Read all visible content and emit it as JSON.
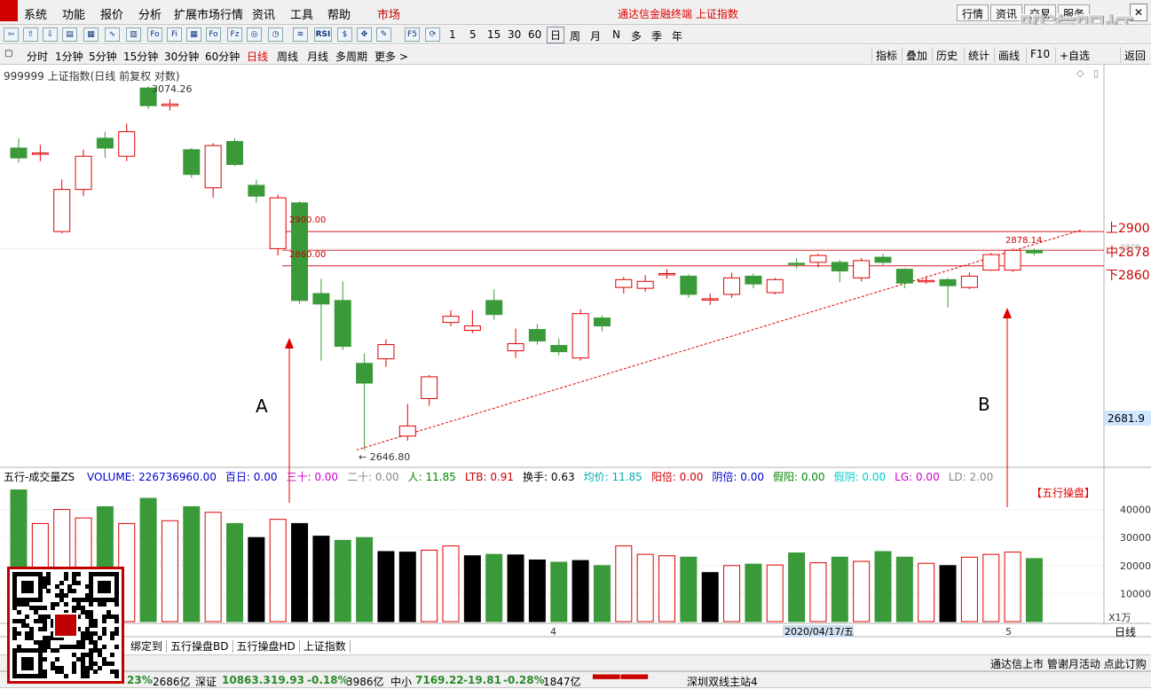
{
  "menu": {
    "items": [
      "系统",
      "功能",
      "报价",
      "分析",
      "扩展市场行情",
      "资讯",
      "工具",
      "帮助"
    ],
    "active": "市场",
    "title": "通达信金融终端 上证指数",
    "right_buttons": [
      "行情",
      "资讯",
      "交易",
      "服务"
    ],
    "watermark": "股海明灯"
  },
  "toolbar": {
    "periods": [
      "1",
      "5",
      "15",
      "30",
      "60"
    ],
    "units": [
      "日",
      "周",
      "月",
      "N",
      "多",
      "季",
      "年"
    ]
  },
  "periodbar": {
    "items": [
      "分时",
      "1分钟",
      "5分钟",
      "15分钟",
      "30分钟",
      "60分钟",
      "日线",
      "周线",
      "月线",
      "多周期",
      "更多 >"
    ],
    "active": "日线",
    "right_tools": [
      "指标",
      "叠加",
      "历史",
      "统计",
      "画线",
      "F10",
      "+自选",
      "返回"
    ]
  },
  "chart": {
    "header": "999999 上证指数(日线 前复权 对数)",
    "high_label": "3074.26",
    "low_label": "2646.80",
    "hline_labels": [
      "2900.00",
      "2860.00"
    ],
    "last_label": "2878.14",
    "right_labels": {
      "upper": "上2900",
      "middle": "中2878",
      "lower": "下2860",
      "cur": "2681.9",
      "top_axis": "2878"
    },
    "annotations": {
      "a": "A",
      "b": "B",
      "box": "【五行操盘】"
    }
  },
  "chart_data": {
    "type": "candlestick",
    "scale": "log",
    "ylim_price": [
      2646.8,
      3074.26
    ],
    "hlines": [
      2900,
      2878,
      2860
    ],
    "candles": [
      {
        "o": 3000,
        "c": 2988,
        "h": 3012,
        "l": 2982
      },
      {
        "o": 2994,
        "c": 2994,
        "h": 3004,
        "l": 2984
      },
      {
        "o": 2900,
        "c": 2950,
        "h": 2962,
        "l": 2898
      },
      {
        "o": 2950,
        "c": 2990,
        "h": 2998,
        "l": 2942
      },
      {
        "o": 3012,
        "c": 3000,
        "h": 3020,
        "l": 2988
      },
      {
        "o": 2990,
        "c": 3020,
        "h": 3030,
        "l": 2984
      },
      {
        "o": 3074,
        "c": 3052,
        "h": 3076,
        "l": 3048
      },
      {
        "o": 3052,
        "c": 3054,
        "h": 3060,
        "l": 3046
      },
      {
        "o": 2998,
        "c": 2968,
        "h": 3000,
        "l": 2964
      },
      {
        "o": 2952,
        "c": 3003,
        "h": 3006,
        "l": 2940
      },
      {
        "o": 3008,
        "c": 2980,
        "h": 3012,
        "l": 2978
      },
      {
        "o": 2955,
        "c": 2942,
        "h": 2962,
        "l": 2934
      },
      {
        "o": 2880,
        "c": 2940,
        "h": 2944,
        "l": 2872
      },
      {
        "o": 2934,
        "c": 2820,
        "h": 2936,
        "l": 2816
      },
      {
        "o": 2828,
        "c": 2816,
        "h": 2845,
        "l": 2752
      },
      {
        "o": 2820,
        "c": 2768,
        "h": 2842,
        "l": 2764
      },
      {
        "o": 2749,
        "c": 2727,
        "h": 2760,
        "l": 2654
      },
      {
        "o": 2754,
        "c": 2770,
        "h": 2776,
        "l": 2745
      },
      {
        "o": 2669,
        "c": 2680,
        "h": 2704,
        "l": 2664
      },
      {
        "o": 2710,
        "c": 2734,
        "h": 2736,
        "l": 2702
      },
      {
        "o": 2795,
        "c": 2802,
        "h": 2809,
        "l": 2791
      },
      {
        "o": 2786,
        "c": 2791,
        "h": 2809,
        "l": 2783
      },
      {
        "o": 2820,
        "c": 2804,
        "h": 2833,
        "l": 2798
      },
      {
        "o": 2763,
        "c": 2771,
        "h": 2788,
        "l": 2755
      },
      {
        "o": 2787,
        "c": 2774,
        "h": 2793,
        "l": 2770
      },
      {
        "o": 2769,
        "c": 2762,
        "h": 2777,
        "l": 2758
      },
      {
        "o": 2755,
        "c": 2805,
        "h": 2810,
        "l": 2752
      },
      {
        "o": 2800,
        "c": 2791,
        "h": 2803,
        "l": 2785
      },
      {
        "o": 2835,
        "c": 2844,
        "h": 2847,
        "l": 2828
      },
      {
        "o": 2834,
        "c": 2842,
        "h": 2849,
        "l": 2830
      },
      {
        "o": 2851,
        "c": 2851,
        "h": 2856,
        "l": 2845
      },
      {
        "o": 2848,
        "c": 2827,
        "h": 2850,
        "l": 2823
      },
      {
        "o": 2822,
        "c": 2822,
        "h": 2828,
        "l": 2815
      },
      {
        "o": 2827,
        "c": 2846,
        "h": 2852,
        "l": 2823
      },
      {
        "o": 2848,
        "c": 2839,
        "h": 2851,
        "l": 2834
      },
      {
        "o": 2829,
        "c": 2844,
        "h": 2846,
        "l": 2827
      },
      {
        "o": 2863,
        "c": 2862,
        "h": 2869,
        "l": 2857
      },
      {
        "o": 2864,
        "c": 2872,
        "h": 2874,
        "l": 2858
      },
      {
        "o": 2864,
        "c": 2854,
        "h": 2867,
        "l": 2841
      },
      {
        "o": 2846,
        "c": 2866,
        "h": 2869,
        "l": 2842
      },
      {
        "o": 2870,
        "c": 2864,
        "h": 2874,
        "l": 2861
      },
      {
        "o": 2856,
        "c": 2840,
        "h": 2857,
        "l": 2834
      },
      {
        "o": 2843,
        "c": 2843,
        "h": 2848,
        "l": 2839
      },
      {
        "o": 2844,
        "c": 2837,
        "h": 2846,
        "l": 2812
      },
      {
        "o": 2835,
        "c": 2848,
        "h": 2852,
        "l": 2833
      },
      {
        "o": 2855,
        "c": 2873,
        "h": 2875,
        "l": 2854
      },
      {
        "o": 2855,
        "c": 2878,
        "h": 2880,
        "l": 2853
      },
      {
        "o": 2878,
        "c": 2875,
        "h": 2880,
        "l": 2872
      }
    ],
    "volume": {
      "ylim": [
        0,
        50000
      ],
      "ticks": [
        40000,
        30000,
        20000,
        10000
      ],
      "unit": "X1万",
      "values": [
        47000,
        35000,
        40000,
        37000,
        41000,
        35000,
        44000,
        36000,
        41000,
        39000,
        35000,
        30000,
        36500,
        35000,
        30500,
        29000,
        30000,
        25000,
        24800,
        25500,
        27000,
        23500,
        24000,
        23800,
        22000,
        21200,
        21800,
        20000,
        27000,
        24000,
        23500,
        23000,
        17500,
        20000,
        20500,
        20200,
        24500,
        21000,
        23000,
        21500,
        25000,
        23000,
        20800,
        20000,
        23000,
        24000,
        24800,
        22500
      ]
    },
    "trend_line": {
      "from_index": 16,
      "from_price": 2654,
      "to_index": 49,
      "to_price": 2902
    }
  },
  "indicator": {
    "name": "五行-成交量ZS",
    "items": [
      {
        "label": "VOLUME: 226736960.00",
        "color": "#0000cc"
      },
      {
        "label": "百日: 0.00",
        "color": "#0000cc"
      },
      {
        "label": "三十: 0.00",
        "color": "#cc00cc"
      },
      {
        "label": "二十: 0.00",
        "color": "#888888"
      },
      {
        "label": "人: 11.85",
        "color": "#008800"
      },
      {
        "label": "LTB: 0.91",
        "color": "#cc0000"
      },
      {
        "label": "换手: 0.63",
        "color": "#000000"
      },
      {
        "label": "均价: 11.85",
        "color": "#00aaaa"
      },
      {
        "label": "阳倍: 0.00",
        "color": "#cc0000"
      },
      {
        "label": "阴倍: 0.00",
        "color": "#0000cc"
      },
      {
        "label": "假阳: 0.00",
        "color": "#008800"
      },
      {
        "label": "假阴: 0.00",
        "color": "#00cccc"
      },
      {
        "label": "LG: 0.00",
        "color": "#cc00cc"
      },
      {
        "label": "LD: 2.00",
        "color": "#888888"
      }
    ]
  },
  "xaxis": {
    "marks": [
      "4",
      "2020/04/17/五",
      "5"
    ],
    "right": "日线"
  },
  "tabs": [
    "绑定到",
    "五行操盘BD",
    "五行操盘HD",
    "上证指数"
  ],
  "status_right": "通达信上市 管谢月活动 点此订购",
  "indexbar": {
    "items": [
      {
        "name": "",
        "value": "",
        "change": "",
        "pct": "23%",
        "amount": "2686亿"
      },
      {
        "name": "深证",
        "value": "10863.3",
        "change": "-19.93",
        "pct": "-0.18%",
        "amount": "3986亿"
      },
      {
        "name": "中小",
        "value": "7169.22",
        "change": "-19.81",
        "pct": "-0.28%",
        "amount": "1847亿"
      }
    ],
    "server": "深圳双线主站4"
  },
  "colors": {
    "up": "#e00000",
    "down": "#3a9a3a",
    "bg": "#ffffff"
  }
}
